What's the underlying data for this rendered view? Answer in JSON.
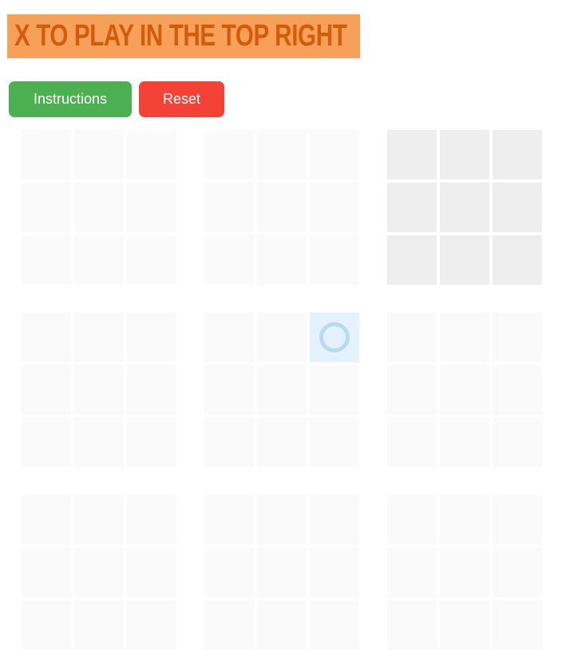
{
  "status": {
    "text": "X TO PLAY IN THE TOP RIGHT"
  },
  "buttons": {
    "instructions_label": "Instructions",
    "reset_label": "Reset"
  },
  "colors": {
    "banner_bg": "#f7a05a",
    "banner_text": "#d35c0a",
    "instructions_bg": "#4caf50",
    "reset_bg": "#f44336",
    "cell_empty": "#fafafa",
    "cell_active_board": "#eeeeee",
    "cell_last_move": "#e3f2fd",
    "o_mark": "#b8daf3"
  },
  "game": {
    "active_board": "top-right",
    "boards": [
      {
        "name": "top-left",
        "cells": [
          "",
          "",
          "",
          "",
          "",
          "",
          "",
          "",
          ""
        ]
      },
      {
        "name": "top-center",
        "cells": [
          "",
          "",
          "",
          "",
          "",
          "",
          "",
          "",
          ""
        ]
      },
      {
        "name": "top-right",
        "cells": [
          "",
          "",
          "",
          "",
          "",
          "",
          "",
          "",
          ""
        ]
      },
      {
        "name": "middle-left",
        "cells": [
          "",
          "",
          "",
          "",
          "",
          "",
          "",
          "",
          ""
        ]
      },
      {
        "name": "middle-center",
        "cells": [
          "",
          "",
          "O",
          "",
          "",
          "",
          "",
          "",
          ""
        ]
      },
      {
        "name": "middle-right",
        "cells": [
          "",
          "",
          "",
          "",
          "",
          "",
          "",
          "",
          ""
        ]
      },
      {
        "name": "bottom-left",
        "cells": [
          "",
          "",
          "",
          "",
          "",
          "",
          "",
          "",
          ""
        ]
      },
      {
        "name": "bottom-center",
        "cells": [
          "",
          "",
          "",
          "",
          "",
          "",
          "",
          "",
          ""
        ]
      },
      {
        "name": "bottom-right",
        "cells": [
          "",
          "",
          "",
          "",
          "",
          "",
          "",
          "",
          ""
        ]
      }
    ],
    "last_move": {
      "board": 4,
      "cell": 2
    }
  }
}
